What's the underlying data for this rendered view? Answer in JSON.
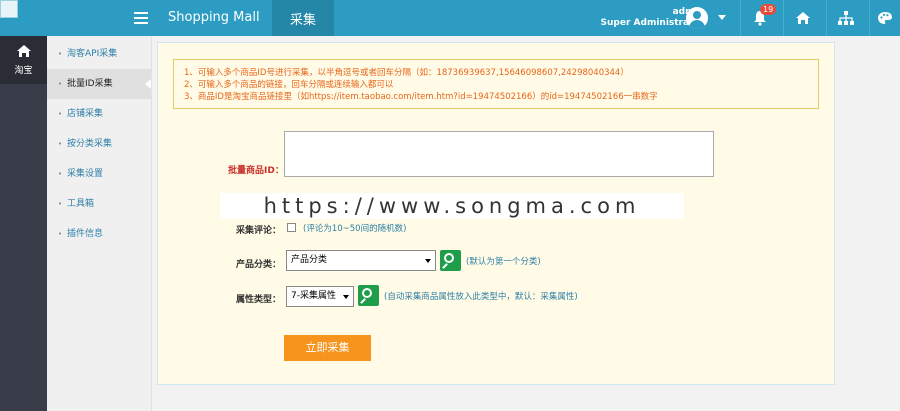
{
  "header": {
    "app_title": "Shopping Mall",
    "active_tab": "采集",
    "user_name": "admin",
    "user_role": "Super Administrator",
    "notification_count": "19",
    "accent_color": "#2c9cc2"
  },
  "rail": {
    "items": [
      {
        "label": "淘宝",
        "icon": "home-icon"
      }
    ]
  },
  "sidebar": {
    "items": [
      {
        "label": "淘客API采集"
      },
      {
        "label": "批量ID采集"
      },
      {
        "label": "店铺采集"
      },
      {
        "label": "按分类采集"
      },
      {
        "label": "采集设置"
      },
      {
        "label": "工具箱"
      },
      {
        "label": "插件信息"
      }
    ],
    "active_index": 1
  },
  "notice": {
    "lines": [
      "1、可输入多个商品ID号进行采集，以半角逗号或者回车分隔（如：18736939637,15646098607,24298040344）",
      "2、可输入多个商品的链接，回车分隔或连续输入都可以",
      "3、商品ID是淘宝商品链接里（如https://item.taobao.com/item.htm?id=19474502166）的id=19474502166一串数字"
    ]
  },
  "form": {
    "batch_id_label": "批量商品ID：",
    "batch_id_value": "",
    "watermark": "https://www.songma.com",
    "comments_label": "采集评论：",
    "comments_hint": "(评论为10~50间的随机数)",
    "category_label": "产品分类：",
    "category_value": "产品分类",
    "category_hint": "(默认为第一个分类)",
    "attr_label": "属性类型：",
    "attr_value": "7-采集属性",
    "attr_hint": "(自动采集商品属性放入此类型中，默认：采集属性)",
    "submit_label": "立即采集"
  }
}
